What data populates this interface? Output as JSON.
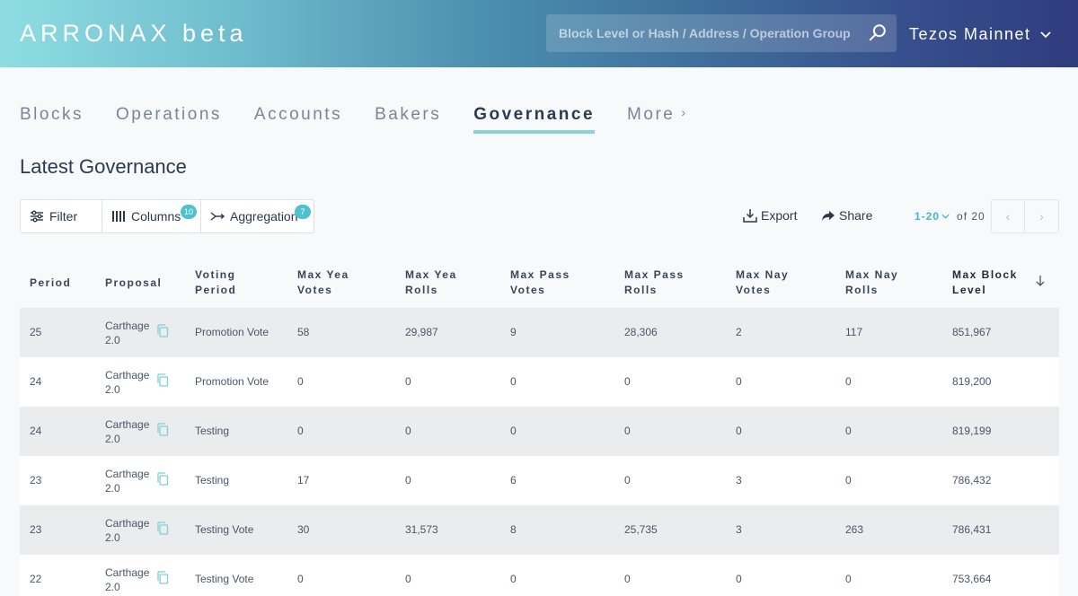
{
  "header": {
    "logo": "ARRONAX beta",
    "search_placeholder": "Block Level or Hash / Address / Operation Group",
    "network": "Tezos Mainnet"
  },
  "tabs": [
    {
      "label": "Blocks"
    },
    {
      "label": "Operations"
    },
    {
      "label": "Accounts"
    },
    {
      "label": "Bakers"
    },
    {
      "label": "Governance"
    },
    {
      "label": "More"
    }
  ],
  "page_title": "Latest Governance",
  "toolbar": {
    "filter": "Filter",
    "columns": "Columns",
    "columns_count": "10",
    "aggregation": "Aggregation",
    "aggregation_count": "7",
    "export": "Export",
    "share": "Share",
    "page_range": "1-20",
    "page_total": "of 20"
  },
  "table": {
    "headers": [
      {
        "line1": "Period",
        "line2": ""
      },
      {
        "line1": "Proposal",
        "line2": ""
      },
      {
        "line1": "Voting",
        "line2": "Period"
      },
      {
        "line1": "Max Yea",
        "line2": "Votes"
      },
      {
        "line1": "Max Yea",
        "line2": "Rolls"
      },
      {
        "line1": "Max Pass",
        "line2": "Votes"
      },
      {
        "line1": "Max Pass",
        "line2": "Rolls"
      },
      {
        "line1": "Max Nay",
        "line2": "Votes"
      },
      {
        "line1": "Max Nay",
        "line2": "Rolls"
      },
      {
        "line1": "Max Block",
        "line2": "Level"
      }
    ],
    "rows": [
      {
        "period": "25",
        "proposal_1": "Carthage",
        "proposal_2": "2.0",
        "voting_period": "Promotion Vote",
        "yea_votes": "58",
        "yea_rolls": "29,987",
        "pass_votes": "9",
        "pass_rolls": "28,306",
        "nay_votes": "2",
        "nay_rolls": "117",
        "block_level": "851,967"
      },
      {
        "period": "24",
        "proposal_1": "Carthage",
        "proposal_2": "2.0",
        "voting_period": "Promotion Vote",
        "yea_votes": "0",
        "yea_rolls": "0",
        "pass_votes": "0",
        "pass_rolls": "0",
        "nay_votes": "0",
        "nay_rolls": "0",
        "block_level": "819,200"
      },
      {
        "period": "24",
        "proposal_1": "Carthage",
        "proposal_2": "2.0",
        "voting_period": "Testing",
        "yea_votes": "0",
        "yea_rolls": "0",
        "pass_votes": "0",
        "pass_rolls": "0",
        "nay_votes": "0",
        "nay_rolls": "0",
        "block_level": "819,199"
      },
      {
        "period": "23",
        "proposal_1": "Carthage",
        "proposal_2": "2.0",
        "voting_period": "Testing",
        "yea_votes": "17",
        "yea_rolls": "0",
        "pass_votes": "6",
        "pass_rolls": "0",
        "nay_votes": "3",
        "nay_rolls": "0",
        "block_level": "786,432"
      },
      {
        "period": "23",
        "proposal_1": "Carthage",
        "proposal_2": "2.0",
        "voting_period": "Testing Vote",
        "yea_votes": "30",
        "yea_rolls": "31,573",
        "pass_votes": "8",
        "pass_rolls": "25,735",
        "nay_votes": "3",
        "nay_rolls": "263",
        "block_level": "786,431"
      },
      {
        "period": "22",
        "proposal_1": "Carthage",
        "proposal_2": "2.0",
        "voting_period": "Testing Vote",
        "yea_votes": "0",
        "yea_rolls": "0",
        "pass_votes": "0",
        "pass_rolls": "0",
        "nay_votes": "0",
        "nay_rolls": "0",
        "block_level": "753,664"
      }
    ]
  },
  "colors": {
    "accent": "#4ec1cf",
    "tab_underline": "#8ad4d8",
    "shaded_row": "#ebecee"
  }
}
